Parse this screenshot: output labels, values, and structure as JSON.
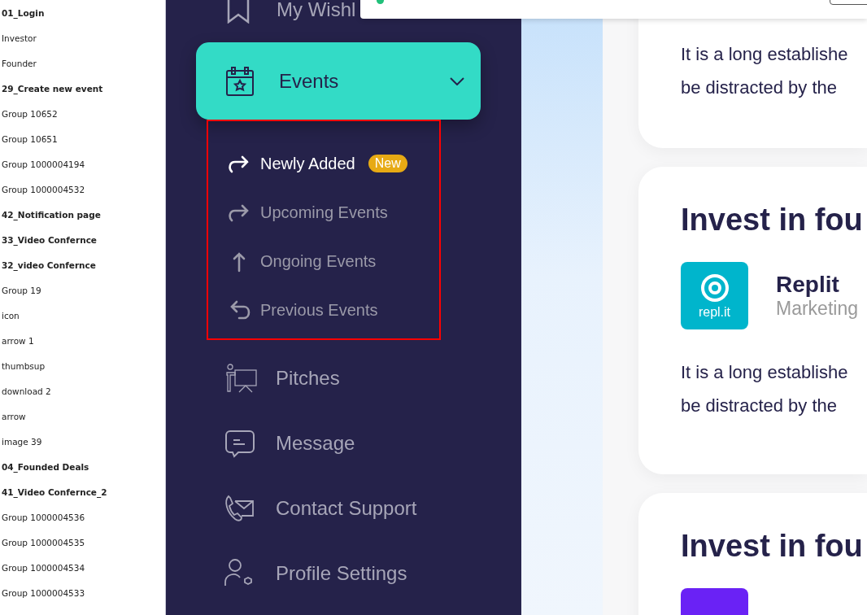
{
  "layers": [
    {
      "name": "01_Login",
      "kind": "frame"
    },
    {
      "name": "Investor",
      "kind": "layer"
    },
    {
      "name": "Founder",
      "kind": "layer"
    },
    {
      "name": "29_Create new event",
      "kind": "frame"
    },
    {
      "name": "Group 10652",
      "kind": "layer"
    },
    {
      "name": "Group 10651",
      "kind": "layer"
    },
    {
      "name": "Group 1000004194",
      "kind": "layer"
    },
    {
      "name": "Group 1000004532",
      "kind": "layer"
    },
    {
      "name": "42_Notification page",
      "kind": "frame"
    },
    {
      "name": "33_Video Confernce",
      "kind": "frame"
    },
    {
      "name": "32_video Confernce",
      "kind": "frame"
    },
    {
      "name": "Group 19",
      "kind": "layer"
    },
    {
      "name": "icon",
      "kind": "layer"
    },
    {
      "name": "arrow 1",
      "kind": "layer"
    },
    {
      "name": "thumbsup",
      "kind": "layer"
    },
    {
      "name": "download 2",
      "kind": "layer"
    },
    {
      "name": "arrow",
      "kind": "layer"
    },
    {
      "name": "image 39",
      "kind": "layer"
    },
    {
      "name": "04_Founded Deals",
      "kind": "frame"
    },
    {
      "name": "41_Video Confernce_2",
      "kind": "frame"
    },
    {
      "name": "Group 1000004536",
      "kind": "layer"
    },
    {
      "name": "Group 1000004535",
      "kind": "layer"
    },
    {
      "name": "Group 1000004534",
      "kind": "layer"
    },
    {
      "name": "Group 1000004533",
      "kind": "layer"
    }
  ],
  "sidebar": {
    "top_item": {
      "label": "My Wishl"
    },
    "events": {
      "label": "Events",
      "expanded": true,
      "submenu": [
        {
          "label": "Newly Added",
          "selected": true,
          "badge": "New"
        },
        {
          "label": "Upcoming Events",
          "selected": false
        },
        {
          "label": "Ongoing Events",
          "selected": false
        },
        {
          "label": "Previous Events",
          "selected": false
        }
      ]
    },
    "items": [
      {
        "label": "Pitches"
      },
      {
        "label": "Message"
      },
      {
        "label": "Contact Support"
      },
      {
        "label": "Profile Settings"
      }
    ]
  },
  "cards": [
    {
      "body": [
        "It is a long establishe",
        "be distracted by the"
      ]
    },
    {
      "title": "Invest in fou",
      "company": {
        "name": "Replit",
        "category": "Marketing",
        "logo_text": "repl.it"
      },
      "body": [
        "It is a long establishe",
        "be distracted by the"
      ]
    },
    {
      "title": "Invest in fou"
    }
  ]
}
